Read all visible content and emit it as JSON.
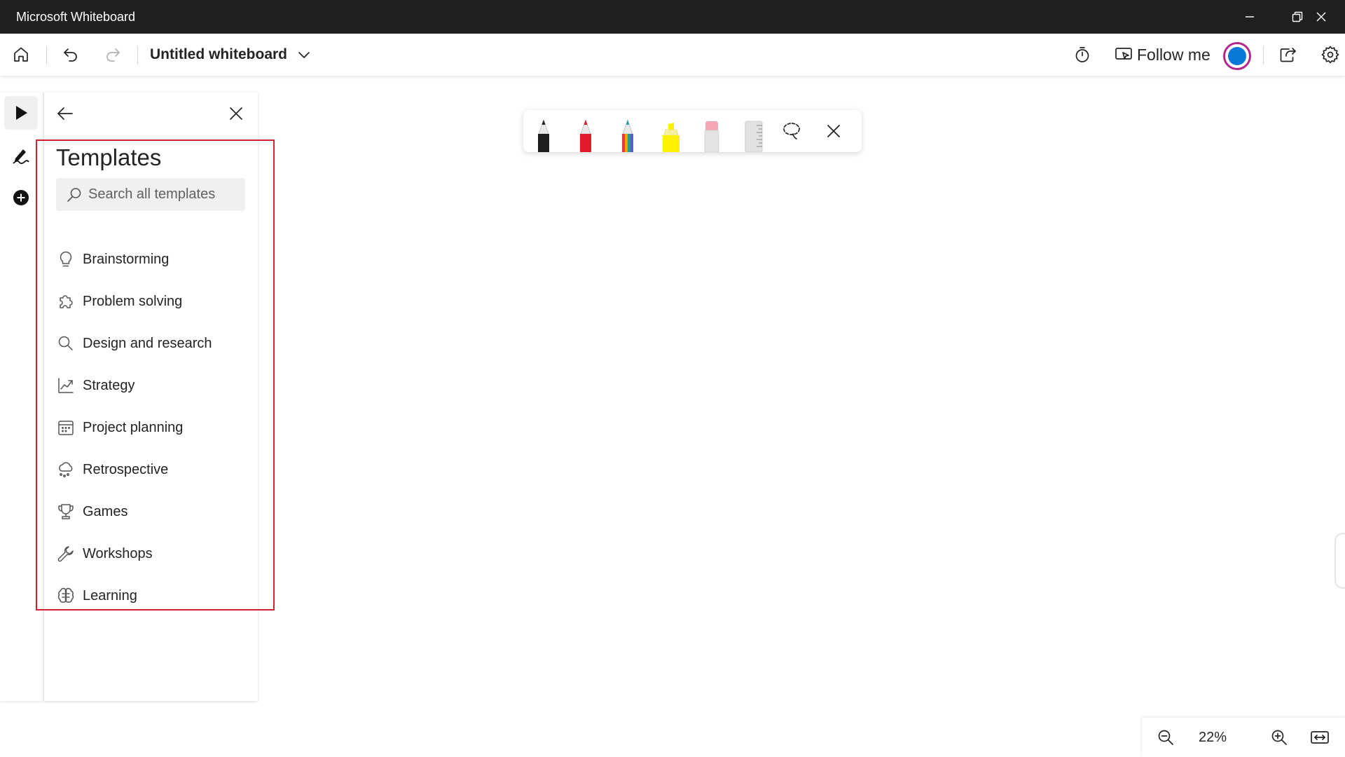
{
  "window": {
    "title": "Microsoft Whiteboard"
  },
  "toolbar": {
    "board_title": "Untitled whiteboard",
    "follow_label": "Follow me"
  },
  "templates_panel": {
    "title": "Templates",
    "search_placeholder": "Search all templates",
    "categories": [
      {
        "label": "Brainstorming",
        "icon": "lightbulb-icon"
      },
      {
        "label": "Problem solving",
        "icon": "puzzle-icon"
      },
      {
        "label": "Design and research",
        "icon": "magnifier-icon"
      },
      {
        "label": "Strategy",
        "icon": "trend-chart-icon"
      },
      {
        "label": "Project planning",
        "icon": "calendar-icon"
      },
      {
        "label": "Retrospective",
        "icon": "cloud-icon"
      },
      {
        "label": "Games",
        "icon": "trophy-icon"
      },
      {
        "label": "Workshops",
        "icon": "wrench-icon"
      },
      {
        "label": "Learning",
        "icon": "brain-icon"
      }
    ]
  },
  "pen_toolbar": {
    "tools": [
      {
        "name": "black-pen",
        "color": "#1e1e1e"
      },
      {
        "name": "red-pen",
        "color": "#e01b2b"
      },
      {
        "name": "rainbow-pen",
        "color": "rainbow"
      },
      {
        "name": "highlighter",
        "color": "#fff200"
      },
      {
        "name": "eraser",
        "color": "#f4a6b4"
      },
      {
        "name": "ruler",
        "color": "#d8d8d8"
      }
    ]
  },
  "zoom": {
    "value": "22%"
  },
  "colors": {
    "titlebar": "#202020",
    "accent_ring": "#b4278c",
    "avatar": "#0a78d7",
    "highlight_box": "#d1202f"
  }
}
